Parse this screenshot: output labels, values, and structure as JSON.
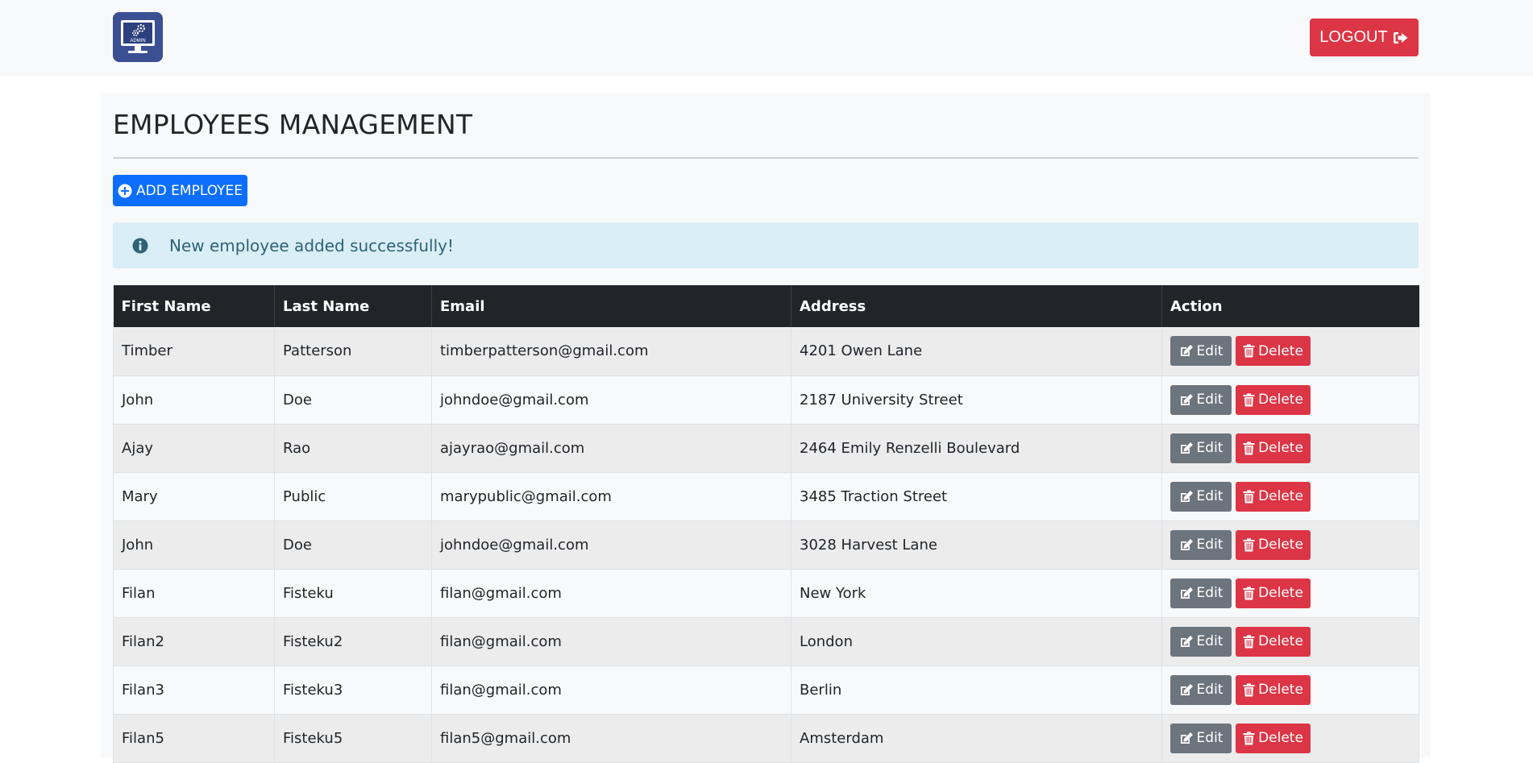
{
  "navbar": {
    "logo_text": "ADMIN",
    "logout_label": "LOGOUT"
  },
  "page": {
    "title": "EMPLOYEES MANAGEMENT",
    "add_button_label": "ADD EMPLOYEE",
    "alert_message": "New employee added successfully!"
  },
  "table": {
    "headers": [
      "First Name",
      "Last Name",
      "Email",
      "Address",
      "Action"
    ],
    "edit_label": "Edit",
    "delete_label": "Delete",
    "rows": [
      {
        "first_name": "Timber",
        "last_name": "Patterson",
        "email": "timberpatterson@gmail.com",
        "address": "4201 Owen Lane"
      },
      {
        "first_name": "John",
        "last_name": "Doe",
        "email": "johndoe@gmail.com",
        "address": "2187 University Street"
      },
      {
        "first_name": "Ajay",
        "last_name": "Rao",
        "email": "ajayrao@gmail.com",
        "address": "2464 Emily Renzelli Boulevard"
      },
      {
        "first_name": "Mary",
        "last_name": "Public",
        "email": "marypublic@gmail.com",
        "address": "3485 Traction Street"
      },
      {
        "first_name": "John",
        "last_name": "Doe",
        "email": "johndoe@gmail.com",
        "address": "3028 Harvest Lane"
      },
      {
        "first_name": "Filan",
        "last_name": "Fisteku",
        "email": "filan@gmail.com",
        "address": "New York"
      },
      {
        "first_name": "Filan2",
        "last_name": "Fisteku2",
        "email": "filan@gmail.com",
        "address": "London"
      },
      {
        "first_name": "Filan3",
        "last_name": "Fisteku3",
        "email": "filan@gmail.com",
        "address": "Berlin"
      },
      {
        "first_name": "Filan5",
        "last_name": "Fisteku5",
        "email": "filan5@gmail.com",
        "address": "Amsterdam"
      }
    ]
  },
  "colors": {
    "primary": "#0d6efd",
    "danger": "#dc3545",
    "secondary": "#6c757d",
    "dark": "#212529",
    "info_bg": "#d9eef6",
    "info_text": "#2f6276",
    "logo_bg": "#3b4f93"
  },
  "icons": {
    "logo": "admin-monitor-gears-icon",
    "logout": "sign-out-icon",
    "add": "plus-circle-icon",
    "alert": "info-circle-icon",
    "edit": "edit-icon",
    "delete": "trash-icon"
  }
}
